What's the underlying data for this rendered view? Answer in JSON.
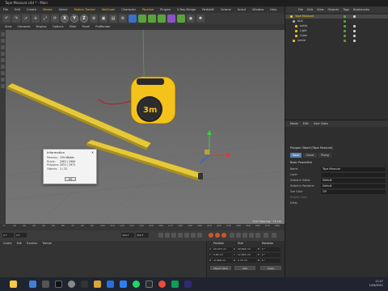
{
  "window": {
    "title": "Tape Measure.c4d * - Main"
  },
  "menubar": {
    "items": [
      "File",
      "Edit",
      "Create",
      "Modes",
      "Select",
      "Motion Tracker",
      "MoGraph",
      "Character",
      "Pipeline",
      "Plugins",
      "V-Ray Bridge",
      "Redshift",
      "Octane",
      "Script",
      "Window",
      "Help"
    ]
  },
  "toolbar": {
    "axis_labels": [
      "X",
      "Y",
      "Z"
    ]
  },
  "viewport": {
    "menu": [
      "View",
      "Cameras",
      "Display",
      "Options",
      "Filter",
      "Panel",
      "ProRender"
    ],
    "grid_spacing": "Grid Spacing : 10 cm",
    "measure_label": "3m"
  },
  "info_dialog": {
    "title": "Information",
    "rows": [
      {
        "k": "Memory:",
        "v": "129 kBytes"
      },
      {
        "k": "Points:",
        "v": "2061 / 2964"
      },
      {
        "k": "Polygons:",
        "v": "2051 / 2971"
      },
      {
        "k": "Objects:",
        "v": "1 / 31"
      }
    ],
    "ok": "OK"
  },
  "timeline": {
    "ticks": [
      "0",
      "10",
      "20",
      "30",
      "40",
      "50",
      "60",
      "70",
      "80",
      "90",
      "100",
      "110",
      "120",
      "130",
      "140",
      "150",
      "160",
      "170",
      "180",
      "190",
      "200",
      "210",
      "220",
      "230",
      "240",
      "250",
      "260",
      "270",
      "280"
    ],
    "start": "0 F",
    "current": "0 F",
    "end": "300 F",
    "end2": "300 F"
  },
  "materials": {
    "menu": [
      "Create",
      "Edit",
      "Function",
      "Texture"
    ]
  },
  "coordinates": {
    "headers": [
      "Position",
      "Size",
      "Rotation"
    ],
    "rows": [
      {
        "axis": "X",
        "pos": "10.475 cm",
        "size": "20.604 cm",
        "rot_axis": "H",
        "rot": "0 °"
      },
      {
        "axis": "Y",
        "pos": "5.82 cm",
        "size": "12.925 cm",
        "rot_axis": "P",
        "rot": "0 °"
      },
      {
        "axis": "Z",
        "pos": "-6.496 cm",
        "size": "1.74 cm",
        "rot_axis": "B",
        "rot": "0 °"
      }
    ],
    "mode": "Object (Rel)",
    "size_mode": "Size",
    "apply": "Apply"
  },
  "objects_panel": {
    "menu": [
      "File",
      "Edit",
      "View",
      "Objects",
      "Tags",
      "Bookmarks"
    ],
    "items": [
      {
        "name": "Tape Measure",
        "depth": 0,
        "selected": true
      },
      {
        "name": "Null",
        "depth": 1,
        "selected": false
      },
      {
        "name": "outils",
        "depth": 2,
        "selected": false
      },
      {
        "name": "Light",
        "depth": 2,
        "selected": false
      },
      {
        "name": "Cube",
        "depth": 2,
        "selected": false
      },
      {
        "name": "metre",
        "depth": 1,
        "selected": false
      }
    ]
  },
  "attributes_panel": {
    "menu": [
      "Mode",
      "Edit",
      "User Data"
    ],
    "object_title": "Polygon Object [Tape Measure]",
    "tabs": [
      "Basic",
      "Coord.",
      "Phong"
    ],
    "section": "Basic Properties",
    "fields": [
      {
        "label": "Name",
        "value": "Tape Measure"
      },
      {
        "label": "Layer",
        "value": ""
      },
      {
        "label": "Visible in Editor",
        "value": "Default"
      },
      {
        "label": "Visible in Renderer",
        "value": "Default"
      },
      {
        "label": "Use Color",
        "value": "Off"
      },
      {
        "label": "Display Color",
        "value": ""
      },
      {
        "label": "X-Ray",
        "value": ""
      }
    ]
  },
  "taskbar": {
    "time": "11:47",
    "date": "1/04/2021"
  }
}
